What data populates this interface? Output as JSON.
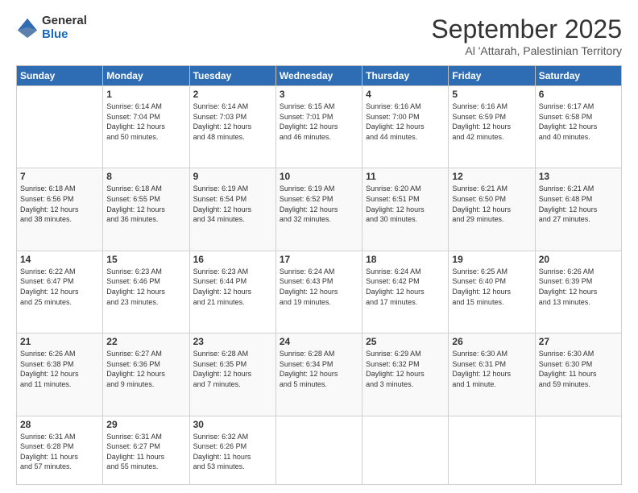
{
  "logo": {
    "general": "General",
    "blue": "Blue"
  },
  "header": {
    "month": "September 2025",
    "location": "Al 'Attarah, Palestinian Territory"
  },
  "weekdays": [
    "Sunday",
    "Monday",
    "Tuesday",
    "Wednesday",
    "Thursday",
    "Friday",
    "Saturday"
  ],
  "weeks": [
    [
      {
        "day": "",
        "info": ""
      },
      {
        "day": "1",
        "info": "Sunrise: 6:14 AM\nSunset: 7:04 PM\nDaylight: 12 hours\nand 50 minutes."
      },
      {
        "day": "2",
        "info": "Sunrise: 6:14 AM\nSunset: 7:03 PM\nDaylight: 12 hours\nand 48 minutes."
      },
      {
        "day": "3",
        "info": "Sunrise: 6:15 AM\nSunset: 7:01 PM\nDaylight: 12 hours\nand 46 minutes."
      },
      {
        "day": "4",
        "info": "Sunrise: 6:16 AM\nSunset: 7:00 PM\nDaylight: 12 hours\nand 44 minutes."
      },
      {
        "day": "5",
        "info": "Sunrise: 6:16 AM\nSunset: 6:59 PM\nDaylight: 12 hours\nand 42 minutes."
      },
      {
        "day": "6",
        "info": "Sunrise: 6:17 AM\nSunset: 6:58 PM\nDaylight: 12 hours\nand 40 minutes."
      }
    ],
    [
      {
        "day": "7",
        "info": "Sunrise: 6:18 AM\nSunset: 6:56 PM\nDaylight: 12 hours\nand 38 minutes."
      },
      {
        "day": "8",
        "info": "Sunrise: 6:18 AM\nSunset: 6:55 PM\nDaylight: 12 hours\nand 36 minutes."
      },
      {
        "day": "9",
        "info": "Sunrise: 6:19 AM\nSunset: 6:54 PM\nDaylight: 12 hours\nand 34 minutes."
      },
      {
        "day": "10",
        "info": "Sunrise: 6:19 AM\nSunset: 6:52 PM\nDaylight: 12 hours\nand 32 minutes."
      },
      {
        "day": "11",
        "info": "Sunrise: 6:20 AM\nSunset: 6:51 PM\nDaylight: 12 hours\nand 30 minutes."
      },
      {
        "day": "12",
        "info": "Sunrise: 6:21 AM\nSunset: 6:50 PM\nDaylight: 12 hours\nand 29 minutes."
      },
      {
        "day": "13",
        "info": "Sunrise: 6:21 AM\nSunset: 6:48 PM\nDaylight: 12 hours\nand 27 minutes."
      }
    ],
    [
      {
        "day": "14",
        "info": "Sunrise: 6:22 AM\nSunset: 6:47 PM\nDaylight: 12 hours\nand 25 minutes."
      },
      {
        "day": "15",
        "info": "Sunrise: 6:23 AM\nSunset: 6:46 PM\nDaylight: 12 hours\nand 23 minutes."
      },
      {
        "day": "16",
        "info": "Sunrise: 6:23 AM\nSunset: 6:44 PM\nDaylight: 12 hours\nand 21 minutes."
      },
      {
        "day": "17",
        "info": "Sunrise: 6:24 AM\nSunset: 6:43 PM\nDaylight: 12 hours\nand 19 minutes."
      },
      {
        "day": "18",
        "info": "Sunrise: 6:24 AM\nSunset: 6:42 PM\nDaylight: 12 hours\nand 17 minutes."
      },
      {
        "day": "19",
        "info": "Sunrise: 6:25 AM\nSunset: 6:40 PM\nDaylight: 12 hours\nand 15 minutes."
      },
      {
        "day": "20",
        "info": "Sunrise: 6:26 AM\nSunset: 6:39 PM\nDaylight: 12 hours\nand 13 minutes."
      }
    ],
    [
      {
        "day": "21",
        "info": "Sunrise: 6:26 AM\nSunset: 6:38 PM\nDaylight: 12 hours\nand 11 minutes."
      },
      {
        "day": "22",
        "info": "Sunrise: 6:27 AM\nSunset: 6:36 PM\nDaylight: 12 hours\nand 9 minutes."
      },
      {
        "day": "23",
        "info": "Sunrise: 6:28 AM\nSunset: 6:35 PM\nDaylight: 12 hours\nand 7 minutes."
      },
      {
        "day": "24",
        "info": "Sunrise: 6:28 AM\nSunset: 6:34 PM\nDaylight: 12 hours\nand 5 minutes."
      },
      {
        "day": "25",
        "info": "Sunrise: 6:29 AM\nSunset: 6:32 PM\nDaylight: 12 hours\nand 3 minutes."
      },
      {
        "day": "26",
        "info": "Sunrise: 6:30 AM\nSunset: 6:31 PM\nDaylight: 12 hours\nand 1 minute."
      },
      {
        "day": "27",
        "info": "Sunrise: 6:30 AM\nSunset: 6:30 PM\nDaylight: 11 hours\nand 59 minutes."
      }
    ],
    [
      {
        "day": "28",
        "info": "Sunrise: 6:31 AM\nSunset: 6:28 PM\nDaylight: 11 hours\nand 57 minutes."
      },
      {
        "day": "29",
        "info": "Sunrise: 6:31 AM\nSunset: 6:27 PM\nDaylight: 11 hours\nand 55 minutes."
      },
      {
        "day": "30",
        "info": "Sunrise: 6:32 AM\nSunset: 6:26 PM\nDaylight: 11 hours\nand 53 minutes."
      },
      {
        "day": "",
        "info": ""
      },
      {
        "day": "",
        "info": ""
      },
      {
        "day": "",
        "info": ""
      },
      {
        "day": "",
        "info": ""
      }
    ]
  ]
}
